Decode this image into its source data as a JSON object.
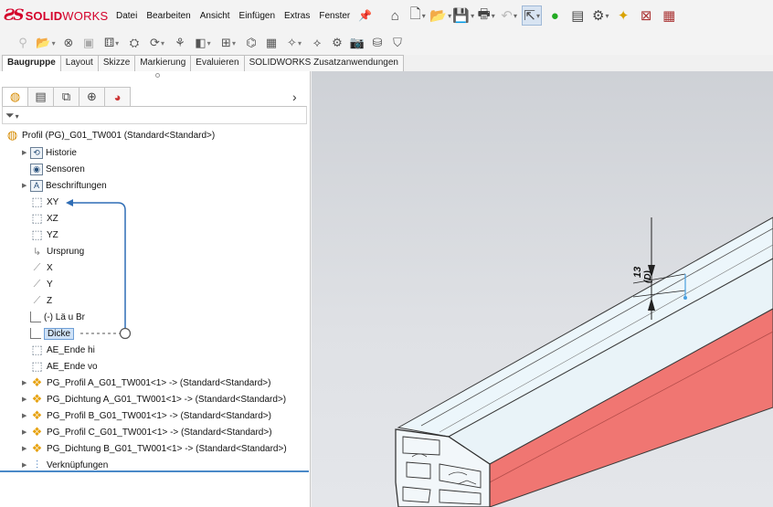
{
  "app": {
    "logo_ds": "ƧS",
    "logo_solid": "SOLID",
    "logo_works": "WORKS"
  },
  "menu": [
    "Datei",
    "Bearbeiten",
    "Ansicht",
    "Einfügen",
    "Extras",
    "Fenster"
  ],
  "command_tabs": [
    "Baugruppe",
    "Layout",
    "Skizze",
    "Markierung",
    "Evaluieren",
    "SOLIDWORKS Zusatzanwendungen"
  ],
  "feature_manager": {
    "root": "Profil (PG)_G01_TW001  (Standard<Standard>)",
    "items": [
      {
        "label": "Historie"
      },
      {
        "label": "Sensoren"
      },
      {
        "label": "Beschriftungen"
      },
      {
        "label": "XY"
      },
      {
        "label": "XZ"
      },
      {
        "label": "YZ"
      },
      {
        "label": "Ursprung"
      },
      {
        "label": "X"
      },
      {
        "label": "Y"
      },
      {
        "label": "Z"
      },
      {
        "label": "(-) Lä u Br"
      },
      {
        "label": "Dicke"
      },
      {
        "label": "AE_Ende hi"
      },
      {
        "label": "AE_Ende vo"
      },
      {
        "label": "PG_Profil A_G01_TW001<1> -> (Standard<Standard>)"
      },
      {
        "label": "PG_Dichtung A_G01_TW001<1> -> (Standard<Standard>)"
      },
      {
        "label": "PG_Profil B_G01_TW001<1> -> (Standard<Standard>)"
      },
      {
        "label": "PG_Profil C_G01_TW001<1> -> (Standard<Standard>)"
      },
      {
        "label": "PG_Dichtung B_G01_TW001<1> -> (Standard<Standard>)"
      },
      {
        "label": "Verknüpfungen"
      }
    ]
  },
  "dimension": {
    "value": "13",
    "ref": "(D)"
  },
  "colors": {
    "seal_red": "#f07672",
    "highlight": "#cfe2f7",
    "annotation_blue": "#2f6db5",
    "brand_red": "#d4002a"
  }
}
